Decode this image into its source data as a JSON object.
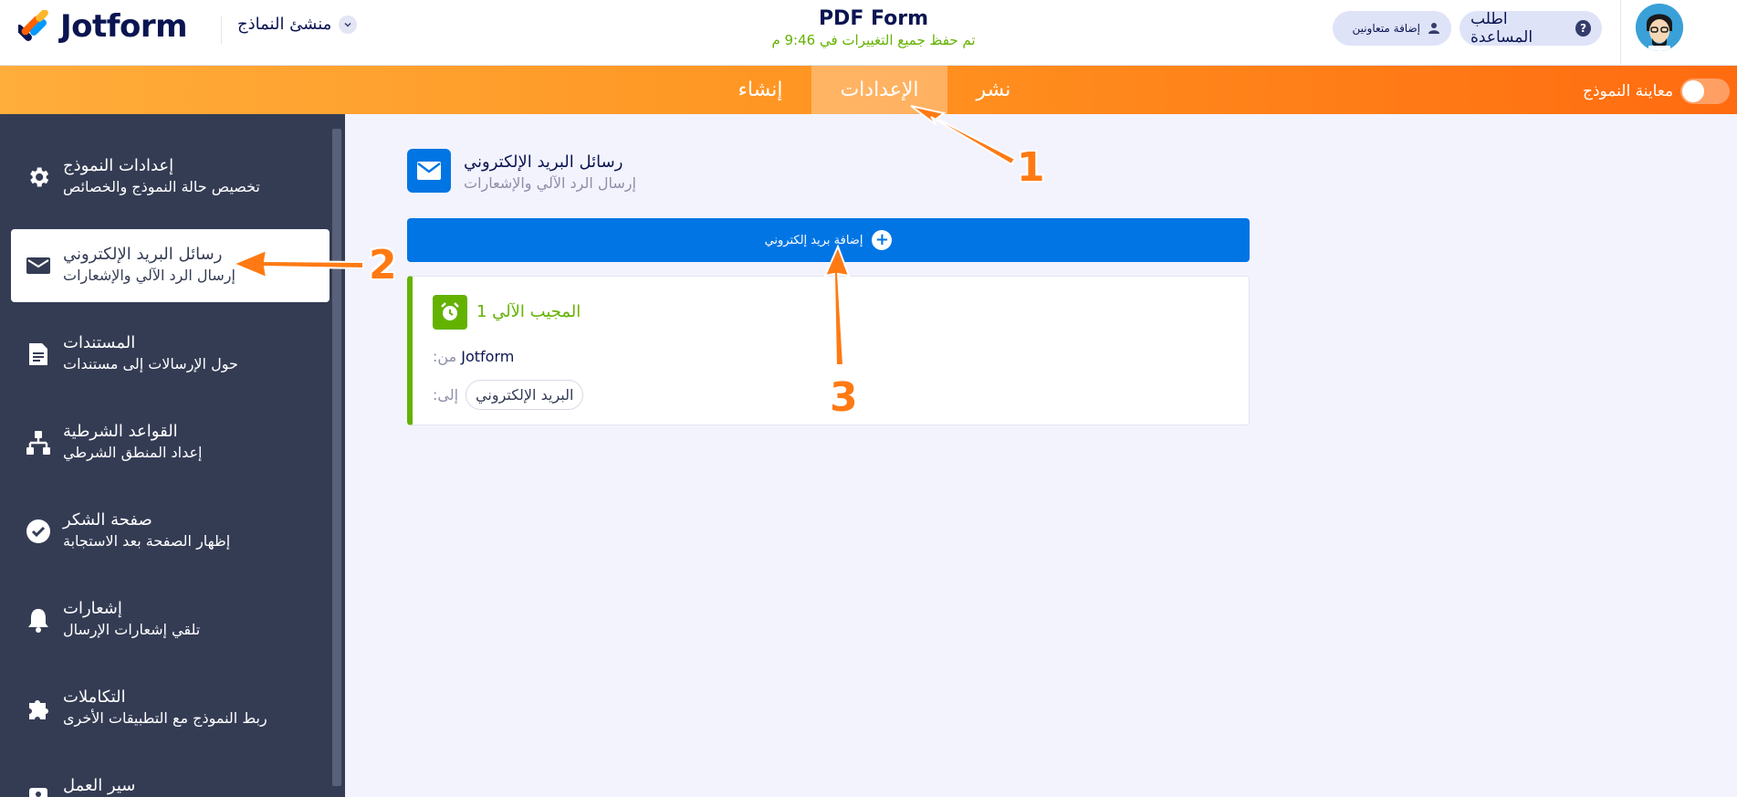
{
  "header": {
    "brand": "Jotform",
    "builder_label": "منشئ النماذج",
    "form_title": "PDF Form",
    "save_status": "تم حفظ جميع التغييرات في 9:46 م",
    "help_label": "اطلب المساعدة",
    "collab_label": "إضافة متعاونين"
  },
  "navbar": {
    "tabs": [
      {
        "label": "إنشاء"
      },
      {
        "label": "الإعدادات"
      },
      {
        "label": "نشر"
      }
    ],
    "active_tab": "الإعدادات",
    "preview_label": "معاينة النموذج",
    "preview_on": false
  },
  "sidebar": {
    "items": [
      {
        "title": "إعدادات النموذج",
        "subtitle": "تخصيص حالة النموذج والخصائص",
        "icon": "gear-icon"
      },
      {
        "title": "رسائل البريد الإلكتروني",
        "subtitle": "إرسال الرد الآلي والإشعارات",
        "icon": "envelope-icon",
        "active": true
      },
      {
        "title": "المستندات",
        "subtitle": "حول الإرسالات إلى مستندات",
        "icon": "document-icon"
      },
      {
        "title": "القواعد الشرطية",
        "subtitle": "إعداد المنطق الشرطي",
        "icon": "conditions-icon"
      },
      {
        "title": "صفحة الشكر",
        "subtitle": "إظهار الصفحة بعد الاستجابة",
        "icon": "check-circle-icon"
      },
      {
        "title": "إشعارات",
        "subtitle": "تلقي إشعارات الإرسال",
        "icon": "bell-icon"
      },
      {
        "title": "التكاملات",
        "subtitle": "ربط النموذج مع التطبيقات الأخرى",
        "icon": "puzzle-icon"
      },
      {
        "title": "سير العمل",
        "subtitle": "",
        "icon": "workflow-icon"
      }
    ]
  },
  "main": {
    "section_title": "رسائل البريد الإلكتروني",
    "section_subtitle": "إرسال الرد الآلي والإشعارات",
    "add_email_label": "إضافة بريد إلكتروني",
    "card": {
      "title": "المجيب الآلي 1",
      "from_label": "من:",
      "from_value": "Jotform",
      "to_label": "إلى:",
      "to_value": "البريد الإلكتروني"
    }
  },
  "annotations": [
    "1",
    "2",
    "3"
  ],
  "colors": {
    "brand_blue": "#0075e3",
    "success_green": "#64b200",
    "nav_orange": "#ff7a13",
    "sidebar_bg": "#343c54"
  }
}
